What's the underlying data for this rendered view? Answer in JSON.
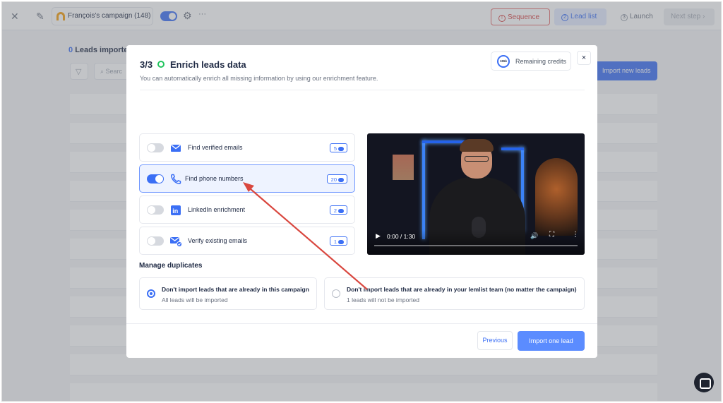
{
  "app": {
    "campaign_name": "François's campaign (148)",
    "close_glyph": "✕",
    "edit_glyph": "✎",
    "settings_glyph": "⚙",
    "more_glyph": "···",
    "nav": {
      "sequence": "Sequence",
      "sequence_icon": "!",
      "lead_list": "Lead list",
      "lead_list_icon": "2",
      "launch": "Launch",
      "launch_icon": "3",
      "next_step": "Next step ›"
    },
    "leads_count": "0",
    "leads_title": "Leads importe",
    "search_placeholder": "Searc",
    "import_new": "Import new leads"
  },
  "modal": {
    "step": "3/3",
    "title": "Enrich leads data",
    "subtitle": "You can automatically enrich all missing information by using our enrichment feature.",
    "credits_value": "155k",
    "credits_label": "Remaining credits",
    "close_glyph": "×",
    "options": [
      {
        "label": "Find verified emails",
        "badge": "5",
        "enabled": false,
        "icon": "envelope-icon"
      },
      {
        "label": "Find phone numbers",
        "badge": "20",
        "enabled": true,
        "icon": "phone-icon"
      },
      {
        "label": "LinkedIn enrichment",
        "badge": "2",
        "enabled": false,
        "icon": "linkedin-icon"
      },
      {
        "label": "Verify existing emails",
        "badge": "1",
        "enabled": false,
        "icon": "verified-envelope-icon"
      }
    ],
    "video": {
      "time": "0:00 / 1:30",
      "play_glyph": "▶",
      "volume_glyph": "🔊",
      "fullscreen_glyph": "⛶",
      "more_glyph": "⋮"
    },
    "duplicates": {
      "heading": "Manage duplicates",
      "option1_title": "Don't import leads that are already in this campaign",
      "option1_sub": "All leads will be imported",
      "option2_title": "Don't import leads that are already in your lemlist team (no matter the campaign)",
      "option2_sub": "1 leads will not be imported",
      "selected": 1
    },
    "previous": "Previous",
    "import": "Import one lead"
  },
  "colors": {
    "accent": "#3b6ff5",
    "annotation_arrow": "#d9473f",
    "sequence_red": "#d64545",
    "step_green": "#22c55e"
  }
}
